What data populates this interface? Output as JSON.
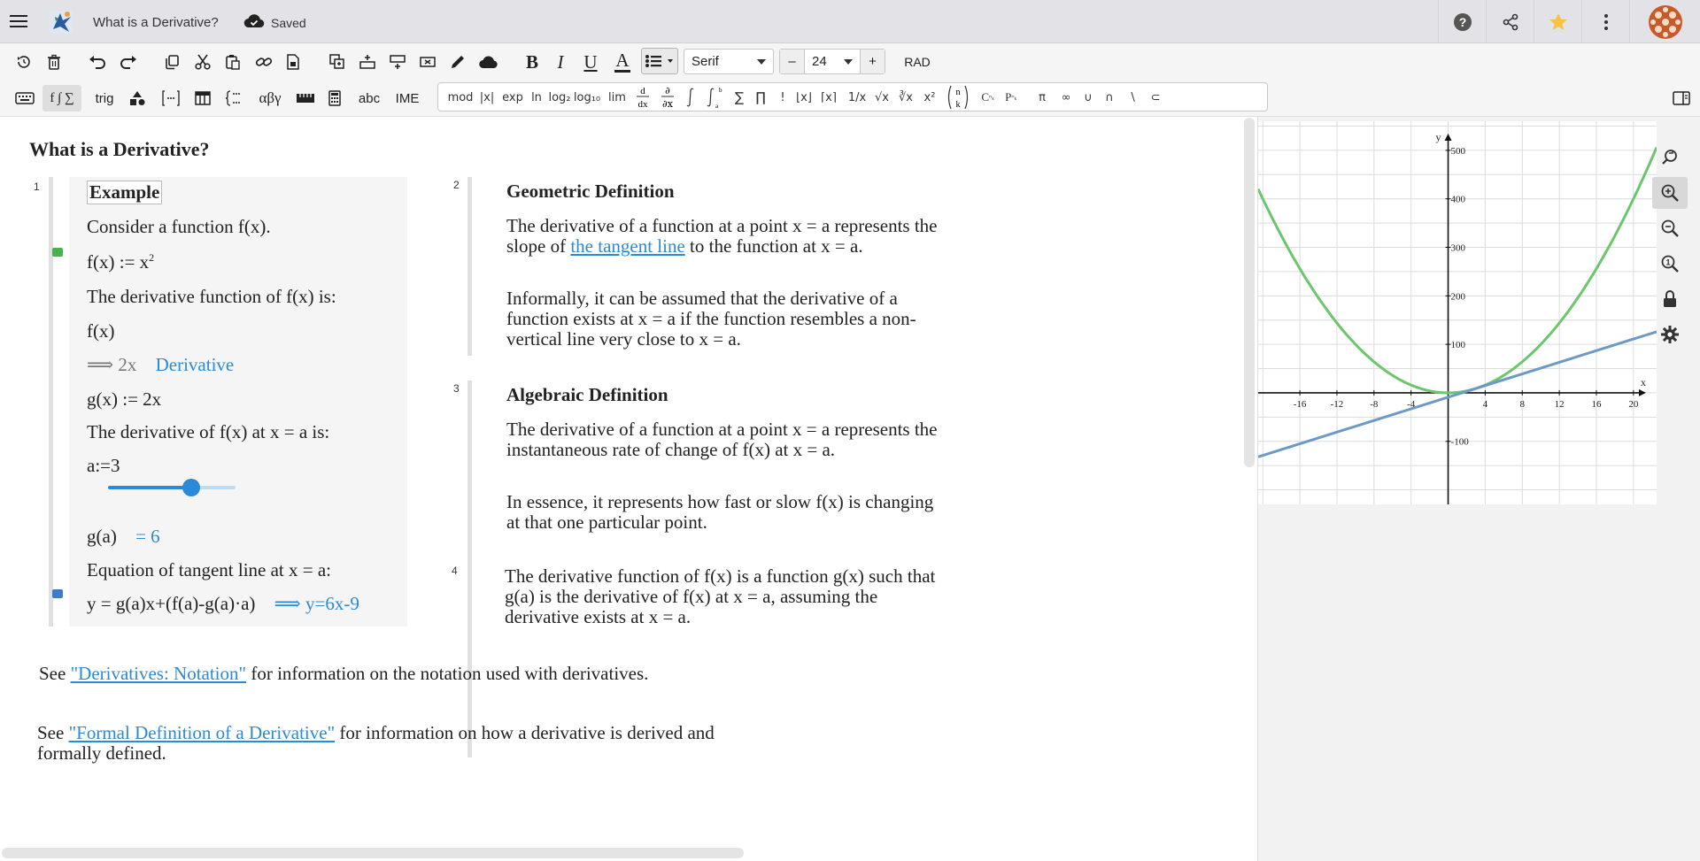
{
  "window": {
    "title": "What is a Derivative?",
    "save_status": "Saved"
  },
  "topbar_icons": [
    "help-icon",
    "share-icon",
    "star-icon",
    "more-vertical-icon",
    "avatar"
  ],
  "colors": {
    "accent": "#2b8ad7",
    "topbar_bg": "#e3e3e7",
    "toolbar_bg": "#f5f5f6",
    "graph_f": "#6cc66c",
    "graph_g": "#6b9ac7",
    "star": "#f6c343"
  },
  "toolbar": {
    "font": "Serif",
    "font_size": "24",
    "minus": "–",
    "plus": "+",
    "angle_mode": "RAD",
    "bold": "B",
    "italic": "I",
    "underline": "U",
    "text_color": "A"
  },
  "tabs": {
    "functions": "f ∫ ∑",
    "trig": "trig",
    "greek": "αβγ",
    "text": "abc",
    "ime": "IME"
  },
  "palette": {
    "mod": "mod",
    "abs": "|x|",
    "exp": "exp",
    "ln": "ln",
    "log2": "log₂",
    "log10": "log₁₀",
    "lim": "lim",
    "sum": "∑",
    "prod": "∏",
    "fact": "!",
    "floor": "⌊x⌋",
    "ceil": "⌈x⌉",
    "recip": "1/x",
    "sqrt": "√x",
    "cbrt": "∛x",
    "power": "x²",
    "combinations": "C",
    "permutations": "P",
    "pi": "π",
    "infinity": "∞",
    "union": "∪",
    "intersection": "∩",
    "setminus": "∖",
    "subset": "⊂"
  },
  "document": {
    "heading": "What is a Derivative?",
    "region1": {
      "number": "1",
      "title": "Example",
      "l1": "Consider a function f(x).",
      "l2": "f(x) := x",
      "l2_sup": "2",
      "l3": "The derivative function of f(x) is:",
      "l4": "f(x)",
      "l5_result": "⟹ 2x",
      "l5_tag": "Derivative",
      "l6": "g(x) := 2x",
      "l7": "The derivative of f(x) at x = a is:",
      "l8": "a:=3",
      "slider_value": 3,
      "l9": "g(a)",
      "l9_result": "= 6",
      "l10": "Equation of tangent line at x = a:",
      "l11": "y = g(a)x+(f(a)-g(a)·a)",
      "l11_result": "⟹ y=6x-9"
    },
    "region2": {
      "number": "2",
      "title": "Geometric Definition",
      "p1_a": "The derivative of a function at a point x = a represents the slope of ",
      "p1_link": "the tangent line",
      "p1_b": " to the function at x = a.",
      "p2": "Informally, it can be assumed that the derivative of a function exists at x = a if the function resembles a non-vertical line very close to x = a."
    },
    "region3": {
      "number": "3",
      "title": "Algebraic Definition",
      "p1": "The derivative of a function at a point x = a represents the instantaneous rate of change of f(x) at x = a.",
      "p2": "In essence, it represents how fast or slow f(x) is changing at that one particular point."
    },
    "region4": {
      "number": "4",
      "p1": "The derivative function of f(x) is a function g(x) such that g(a) is the derivative of f(x) at x = a, assuming the derivative exists at x = a."
    },
    "footer1": {
      "pre": "See ",
      "link": "\"Derivatives: Notation\"",
      "post": " for information on the notation used with derivatives."
    },
    "footer2": {
      "pre": "See ",
      "link": "\"Formal Definition of a Derivative\"",
      "post": " for information on how a derivative is derived and formally defined."
    }
  },
  "graph": {
    "x_axis_label": "x",
    "y_axis_label": "y",
    "x_ticks": [
      "-16",
      "-12",
      "-8",
      "-4",
      "4",
      "8",
      "12",
      "16",
      "20"
    ],
    "y_ticks": [
      "500",
      "400",
      "300",
      "200",
      "100",
      "-100"
    ],
    "tools": [
      "zoom-reset-icon",
      "zoom-in-icon",
      "zoom-out-icon",
      "zoom-fit-icon",
      "lock-icon",
      "settings-icon"
    ]
  }
}
